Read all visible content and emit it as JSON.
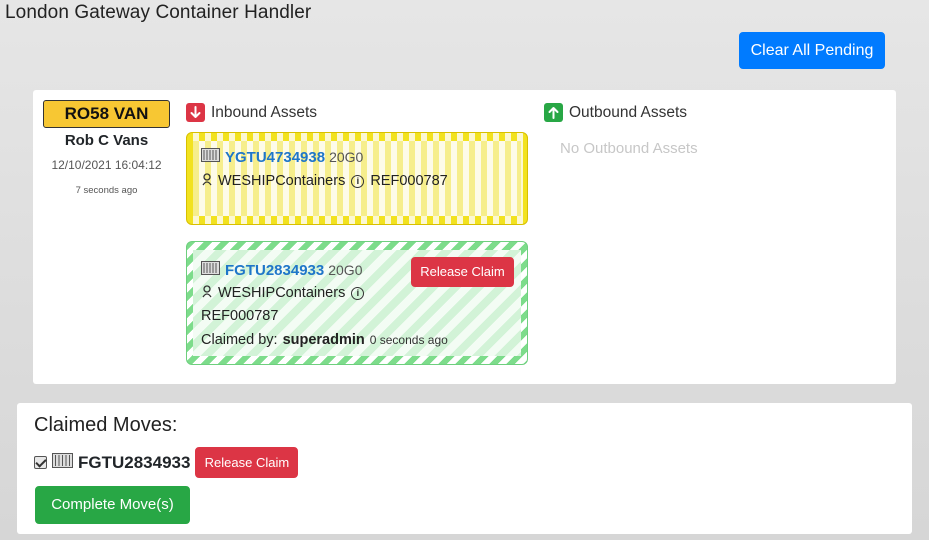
{
  "app": {
    "title": "London Gateway Container Handler"
  },
  "toolbar": {
    "clear_all_label": "Clear All Pending"
  },
  "vehicle": {
    "plate": "RO58 VAN",
    "driver": "Rob C Vans",
    "datetime": "12/10/2021 16:04:12",
    "ago": "7 seconds ago"
  },
  "inbound": {
    "label": "Inbound Assets",
    "assets": [
      {
        "id": "YGTU4734938",
        "type": "20G0",
        "owner": "WESHIPContainers",
        "ref": "REF000787",
        "color": "#f2e21f"
      },
      {
        "id": "FGTU2834933",
        "type": "20G0",
        "owner": "WESHIPContainers",
        "ref": "REF000787",
        "claimed_by_label": "Claimed by:",
        "claimed_by_user": "superadmin",
        "claimed_ago": "0 seconds ago",
        "release_label": "Release Claim",
        "color": "#7ddc8b"
      }
    ]
  },
  "outbound": {
    "label": "Outbound Assets",
    "empty_text": "No Outbound Assets"
  },
  "claimed": {
    "title": "Claimed Moves:",
    "items": [
      {
        "id": "FGTU2834933",
        "checked": true,
        "release_label": "Release Claim"
      }
    ],
    "complete_label": "Complete Move(s)"
  },
  "colors": {
    "primary": "#007bff",
    "danger": "#dc3545",
    "success": "#28a745",
    "plate": "#f7c733",
    "link": "#1f76c9"
  },
  "icons": [
    "container-icon",
    "owner-icon",
    "info-icon",
    "arrow-down-icon",
    "arrow-up-icon",
    "checkbox-checked-icon"
  ]
}
